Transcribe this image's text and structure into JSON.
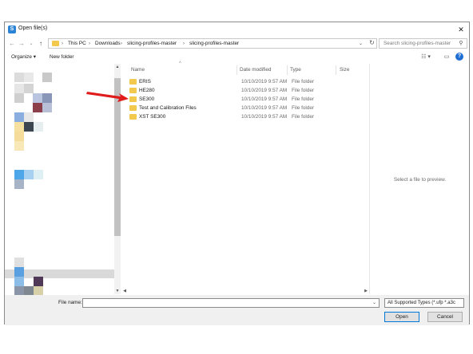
{
  "window": {
    "title": "Open file(s)",
    "close_symbol": "✕"
  },
  "nav": {
    "back": "←",
    "forward": "→",
    "dropdown": "⌄",
    "up": "↑",
    "breadcrumbs": [
      "This PC",
      "Downloads",
      "slicing-profiles-master",
      "slicing-profiles-master"
    ],
    "separator": "›",
    "refresh": "↻",
    "search_placeholder": "Search slicing-profiles-master"
  },
  "toolbar": {
    "organize": "Organize ▾",
    "new_folder": "New folder",
    "view_icon": "☷ ▾",
    "pane_icon": "▭",
    "help": "?"
  },
  "columns": {
    "name": "Name",
    "date_modified": "Date modified",
    "type": "Type",
    "size": "Size"
  },
  "files": [
    {
      "name": "ERIS",
      "date": "10/10/2019 9:57 AM",
      "type": "File folder"
    },
    {
      "name": "HE280",
      "date": "10/10/2019 9:57 AM",
      "type": "File folder"
    },
    {
      "name": "SE300",
      "date": "10/10/2019 9:57 AM",
      "type": "File folder"
    },
    {
      "name": "Test and Calibration Files",
      "date": "10/10/2019 9:57 AM",
      "type": "File folder"
    },
    {
      "name": "XST SE300",
      "date": "10/10/2019 9:57 AM",
      "type": "File folder"
    }
  ],
  "preview": {
    "text": "Select a file to preview."
  },
  "bottom": {
    "file_name_label": "File name:",
    "file_name_value": "",
    "filter_value": "All Supported Types (*.ufp *.a3c",
    "open_label": "Open",
    "cancel_label": "Cancel"
  },
  "colors": {
    "folder": "#f2c94c",
    "accent": "#0078d7",
    "arrow": "#e01b1b"
  }
}
